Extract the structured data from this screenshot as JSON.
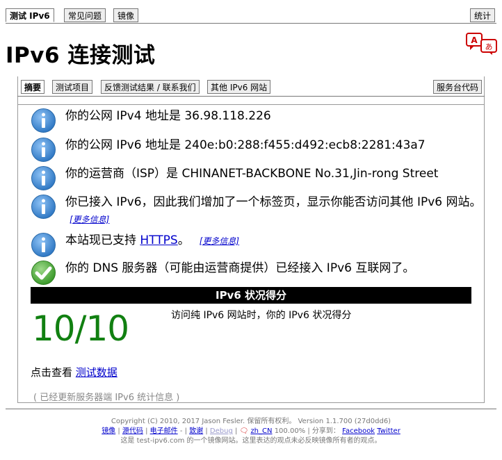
{
  "top_tabs": [
    {
      "label": "测试 IPv6"
    },
    {
      "label": "常见问题"
    },
    {
      "label": "镜像"
    },
    {
      "label": "统计"
    }
  ],
  "page_title": "IPv6 连接测试",
  "inner_tabs": [
    {
      "label": "摘要"
    },
    {
      "label": "测试项目"
    },
    {
      "label": "反馈测试结果 / 联系我们"
    },
    {
      "label": "其他 IPv6 网站"
    },
    {
      "label": "服务台代码"
    }
  ],
  "results": [
    {
      "text": "你的公网 IPv4 地址是 36.98.118.226",
      "icon": "info-icon"
    },
    {
      "text": "你的公网 IPv6 地址是 240e:b0:288:f455:d492:ecb8:2281:43a7",
      "icon": "info-icon"
    },
    {
      "text": "你的运营商（ISP）是 CHINANET-BACKBONE No.31,Jin-rong Street",
      "icon": "info-icon"
    },
    {
      "text": "你已接入 IPv6，因此我们增加了一个标签页，显示你能否访问其他 IPv6 网站。",
      "icon": "info-icon",
      "more": "[更多信息]"
    },
    {
      "text_before": "本站现已支持 ",
      "link": "HTTPS",
      "text_after": "。",
      "icon": "info-icon",
      "more": "[更多信息]"
    },
    {
      "text": "你的 DNS 服务器（可能由运营商提供）已经接入 IPv6 互联网了。",
      "icon": "check-icon"
    }
  ],
  "score": {
    "header": "IPv6 状况得分",
    "value": "10/10",
    "description": "访问纯 IPv6 网站时，你的 IPv6 状况得分"
  },
  "click_see": {
    "prefix": "点击查看 ",
    "link": "测试数据"
  },
  "updated_note": "( 已经更新服务器端 IPv6 统计信息 )",
  "footer": {
    "copyright": "Copyright (C) 2010, 2017 Jason Fesler. 保留所有权利。 Version 1.1.700 (27d0dd6)",
    "links": [
      "镜像",
      "源代码",
      "电子邮件",
      "致谢",
      "Debug"
    ],
    "sep_dash": " - ",
    "locale": "zh_CN",
    "locale_pct": "100.00%",
    "share_label": "分享到：",
    "share_links": [
      "Facebook",
      "Twitter"
    ],
    "mirror_note": "这是 test-ipv6.com 的一个镜像网站。这里表达的观点未必反映镜像所有者的观点。"
  },
  "colors": {
    "score_green": "#118011",
    "info_blue": "#2f78c4",
    "check_green": "#3a9a2a",
    "link": "#0000cc"
  }
}
